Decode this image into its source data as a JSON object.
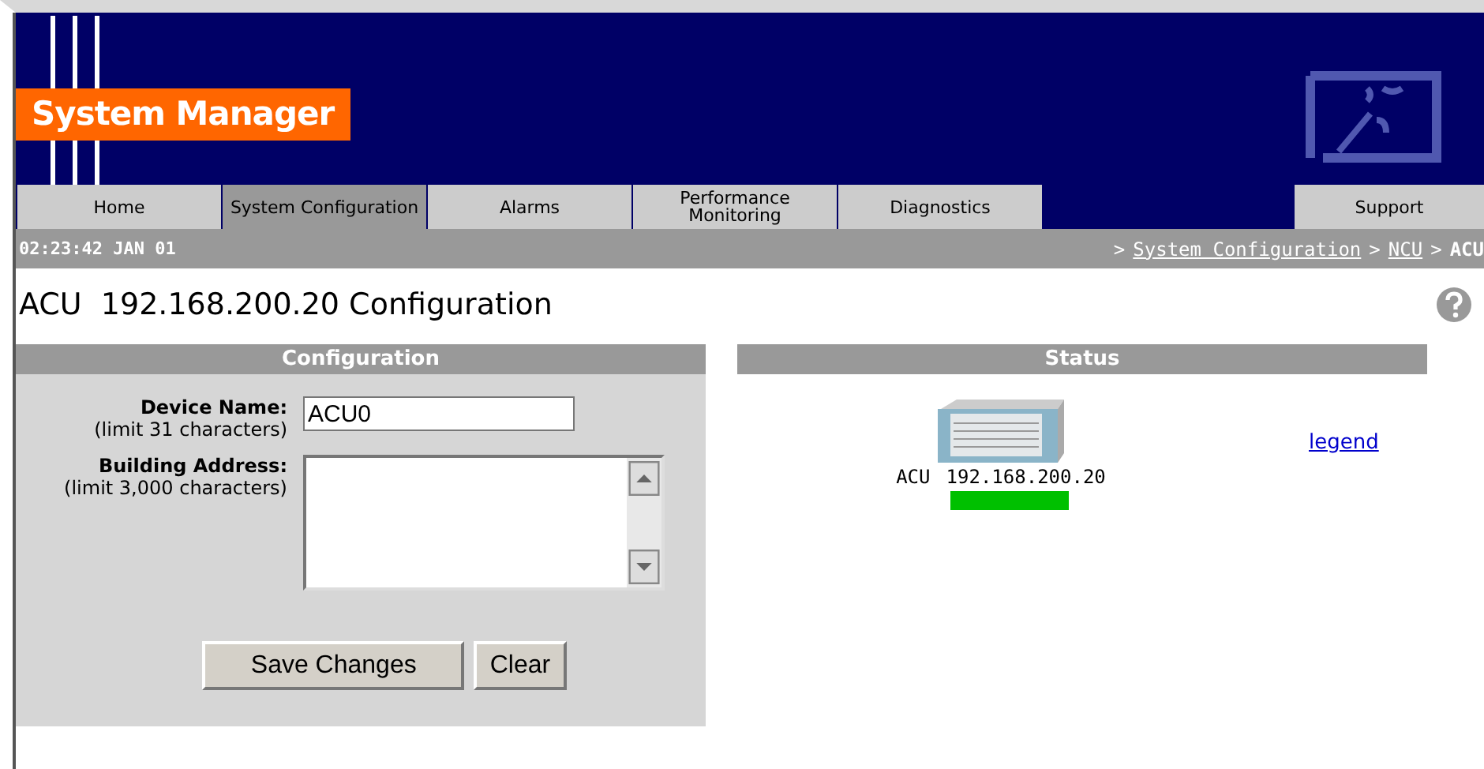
{
  "header": {
    "title": "System Manager"
  },
  "tabs": [
    {
      "label": "Home",
      "selected": false
    },
    {
      "label": "System Configuration",
      "selected": true
    },
    {
      "label": "Alarms",
      "selected": false
    },
    {
      "label": "Performance Monitoring",
      "selected": false
    },
    {
      "label": "Diagnostics",
      "selected": false
    },
    {
      "label": "Support",
      "selected": false
    }
  ],
  "status_bar": {
    "time": "02:23:42 JAN 01",
    "separator": ">",
    "breadcrumb": [
      {
        "label": "System Configuration",
        "kind": "link"
      },
      {
        "label": "NCU",
        "kind": "link"
      },
      {
        "label": "ACU",
        "kind": "current"
      }
    ]
  },
  "page_title": "ACU  192.168.200.20 Configuration",
  "configuration": {
    "heading": "Configuration",
    "fields": [
      {
        "label": "Device Name:",
        "hint": "(limit 31 characters)",
        "kind": "text",
        "value": "ACU0"
      },
      {
        "label": "Building Address:",
        "hint": "(limit 3,000 characters)",
        "kind": "textarea"
      }
    ],
    "buttons": [
      "Save Changes",
      "Clear"
    ]
  },
  "status": {
    "heading": "Status",
    "device": {
      "name": "ACU",
      "address": "192.168.200.20",
      "color": "#00c000"
    },
    "legend": "legend"
  }
}
